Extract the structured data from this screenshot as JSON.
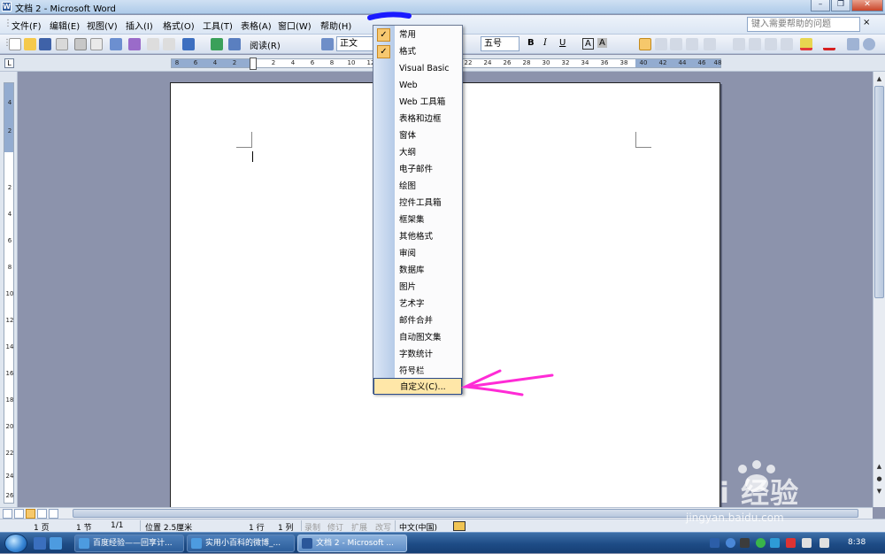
{
  "window": {
    "title": "文档 2 - Microsoft Word",
    "app_icon": "W"
  },
  "menubar": {
    "items": [
      "文件(F)",
      "编辑(E)",
      "视图(V)",
      "插入(I)",
      "格式(O)",
      "工具(T)",
      "表格(A)",
      "窗口(W)",
      "帮助(H)"
    ],
    "help_placeholder": "键入需要帮助的问题",
    "help_close": "×"
  },
  "toolbar": {
    "read_mode": "阅读(R)",
    "style": "正文",
    "font_size": "五号",
    "bold": "B",
    "italic": "I",
    "underline": "U",
    "char_border": "A",
    "char_shading": "A"
  },
  "ruler": {
    "left_ticks": [
      "8",
      "6",
      "4",
      "2"
    ],
    "right_ticks": [
      "2",
      "4",
      "6",
      "8",
      "10",
      "12",
      "14",
      "16",
      "18",
      "20",
      "22",
      "24",
      "26",
      "28",
      "30",
      "32",
      "34",
      "36",
      "38",
      "40",
      "42",
      "44",
      "46",
      "48"
    ],
    "tab_selector": "L",
    "vertical_ticks": [
      "4",
      "2",
      "2",
      "4",
      "6",
      "8",
      "10",
      "12",
      "14",
      "16",
      "18",
      "20",
      "22",
      "24",
      "26"
    ]
  },
  "toolbars_menu": {
    "items": [
      {
        "label": "常用",
        "checked": true
      },
      {
        "label": "格式",
        "checked": true
      },
      {
        "label": "Visual Basic",
        "checked": false
      },
      {
        "label": "Web",
        "checked": false
      },
      {
        "label": "Web 工具箱",
        "checked": false
      },
      {
        "label": "表格和边框",
        "checked": false
      },
      {
        "label": "窗体",
        "checked": false
      },
      {
        "label": "大纲",
        "checked": false
      },
      {
        "label": "电子邮件",
        "checked": false
      },
      {
        "label": "绘图",
        "checked": false
      },
      {
        "label": "控件工具箱",
        "checked": false
      },
      {
        "label": "框架集",
        "checked": false
      },
      {
        "label": "其他格式",
        "checked": false
      },
      {
        "label": "审阅",
        "checked": false
      },
      {
        "label": "数据库",
        "checked": false
      },
      {
        "label": "图片",
        "checked": false
      },
      {
        "label": "艺术字",
        "checked": false
      },
      {
        "label": "邮件合并",
        "checked": false
      },
      {
        "label": "自动图文集",
        "checked": false
      },
      {
        "label": "字数统计",
        "checked": false
      },
      {
        "label": "符号栏",
        "checked": false
      },
      {
        "label": "自定义(C)...",
        "checked": false,
        "highlighted": true
      }
    ],
    "check_mark": "✓"
  },
  "statusbar": {
    "page": "1 页",
    "section": "1 节",
    "page_of": "1/1",
    "position": "位置 2.5厘米",
    "line": "1 行",
    "column": "1 列",
    "record": "录制",
    "track": "修订",
    "extend": "扩展",
    "overtype": "改写",
    "language": "中文(中国)"
  },
  "taskbar": {
    "buttons": [
      {
        "label": "百度经验——回享计...",
        "active": false
      },
      {
        "label": "实用小百科的微博_...",
        "active": false
      },
      {
        "label": "文档 2 - Microsoft ...",
        "active": true
      }
    ],
    "clock": "8:38"
  },
  "watermark": {
    "brand": "Bai 经验",
    "url": "jingyan.baidu.com"
  },
  "colors": {
    "annotation_arrow": "#ff2bd6",
    "annotation_underline": "#1a1aff",
    "menu_highlight": "#ffe7a8"
  }
}
